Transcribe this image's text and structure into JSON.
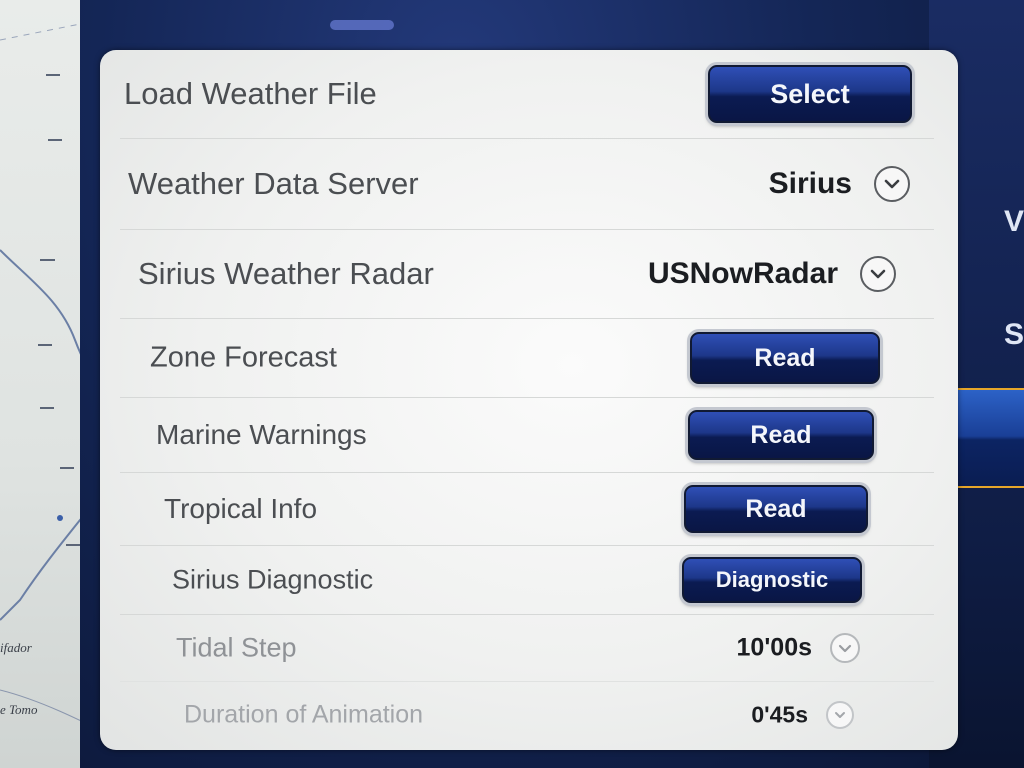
{
  "chart": {
    "place_labels": [
      "ifador",
      "e Tomo"
    ]
  },
  "right_panel": {
    "glyph_top": "V",
    "glyph_mid": "S"
  },
  "settings": {
    "load_weather_file": {
      "label": "Load Weather File",
      "button": "Select"
    },
    "weather_data_server": {
      "label": "Weather Data Server",
      "value": "Sirius"
    },
    "sirius_weather_radar": {
      "label": "Sirius Weather Radar",
      "value": "USNowRadar"
    },
    "zone_forecast": {
      "label": "Zone Forecast",
      "button": "Read"
    },
    "marine_warnings": {
      "label": "Marine Warnings",
      "button": "Read"
    },
    "tropical_info": {
      "label": "Tropical Info",
      "button": "Read"
    },
    "sirius_diagnostic": {
      "label": "Sirius Diagnostic",
      "button": "Diagnostic"
    },
    "tidal_step": {
      "label": "Tidal Step",
      "value": "10'00s"
    },
    "duration_of_animation": {
      "label": "Duration of Animation",
      "value": "0'45s"
    }
  },
  "colors": {
    "button_blue": "#1d3789",
    "accent_orange": "#e6a62a",
    "frame_navy": "#142656"
  },
  "icons": [
    "chevron-down-icon"
  ]
}
